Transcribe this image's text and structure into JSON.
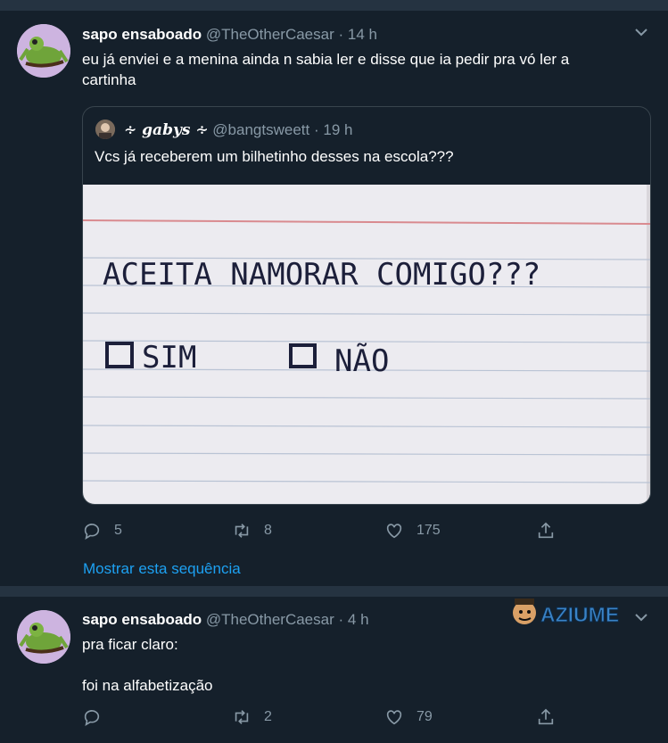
{
  "tweet1": {
    "name": "sapo ensaboado",
    "handle": "@TheOtherCaesar",
    "separator": "·",
    "time": "14 h",
    "text_line1": "eu já enviei e a menina ainda n sabia ler e disse que ia pedir pra vó ler a",
    "text_line2": "cartinha",
    "quote": {
      "name": "∻ 𝒈𝒂𝒃𝒚𝒔 ∻",
      "handle": "@bangtsweett",
      "separator": "·",
      "time": "19 h",
      "text": "Vcs já receberem um bilhetinho desses na escola???",
      "note": {
        "line1": "ACEITA NAMORAR COMIGO???",
        "option_yes": "SIM",
        "option_no": "NÃO"
      }
    },
    "replies": "5",
    "retweets": "8",
    "likes": "175",
    "show_thread": "Mostrar esta sequência"
  },
  "tweet2": {
    "name": "sapo ensaboado",
    "handle": "@TheOtherCaesar",
    "separator": "·",
    "time": "4 h",
    "text_line1": "pra ficar claro:",
    "text_line2": "foi na alfabetização",
    "replies": "",
    "retweets": "2",
    "likes": "79"
  },
  "watermark": "AZIUME",
  "icons": [
    "chevron-down-icon",
    "reply-icon",
    "retweet-icon",
    "like-icon",
    "share-icon"
  ],
  "colors": {
    "background": "#15202b",
    "muted": "#8899a6",
    "link": "#1da1f2",
    "divider": "#253341"
  }
}
